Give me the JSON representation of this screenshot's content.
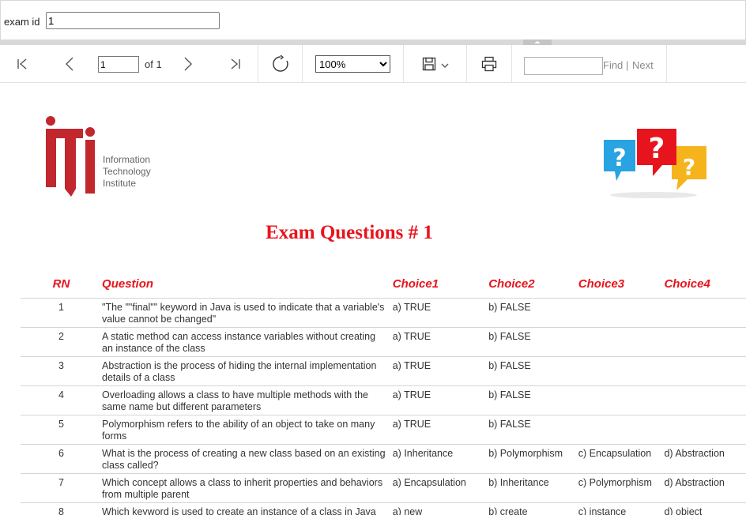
{
  "parameters": {
    "exam_id_label": "exam id",
    "exam_id_value": "1"
  },
  "toolbar": {
    "current_page": "1",
    "page_total_text": "of 1",
    "zoom_options": [
      "100%"
    ],
    "zoom_selected": "100%",
    "find_placeholder": "",
    "find_label": "Find",
    "separator": "|",
    "next_label": "Next",
    "icons": [
      "first-page-icon",
      "previous-page-icon",
      "next-page-icon",
      "last-page-icon",
      "refresh-icon",
      "save-icon",
      "chevron-down-icon",
      "print-icon"
    ]
  },
  "report": {
    "logo": {
      "line1": "Information",
      "line2": "Technology",
      "line3": "Institute",
      "colors": {
        "red": "#c1272d",
        "gray": "#666666"
      }
    },
    "title": "Exam Questions # 1",
    "title_color": "#e8141d",
    "columns": [
      "RN",
      "Question",
      "Choice1",
      "Choice2",
      "Choice3",
      "Choice4"
    ],
    "rows": [
      {
        "rn": "1",
        "question": "\"The \"\"final\"\" keyword in Java is used to indicate that a variable's value cannot be changed\"",
        "c1": "a) TRUE",
        "c2": "b) FALSE",
        "c3": "",
        "c4": ""
      },
      {
        "rn": "2",
        "question": "A static method can access instance variables without creating an instance of the class",
        "c1": "a) TRUE",
        "c2": "b) FALSE",
        "c3": "",
        "c4": ""
      },
      {
        "rn": "3",
        "question": "Abstraction is the process of hiding the internal implementation details of a class",
        "c1": "a) TRUE",
        "c2": "b) FALSE",
        "c3": "",
        "c4": ""
      },
      {
        "rn": "4",
        "question": "Overloading allows a class to have multiple methods with the same name but different parameters",
        "c1": "a) TRUE",
        "c2": "b) FALSE",
        "c3": "",
        "c4": ""
      },
      {
        "rn": "5",
        "question": "Polymorphism refers to the ability of an object to take on many forms",
        "c1": "a) TRUE",
        "c2": "b) FALSE",
        "c3": "",
        "c4": ""
      },
      {
        "rn": "6",
        "question": "What is the process of creating a new class based on an existing class called?",
        "c1": "a) Inheritance",
        "c2": "b) Polymorphism",
        "c3": "c) Encapsulation",
        "c4": "d) Abstraction"
      },
      {
        "rn": "7",
        "question": "Which concept allows a class to inherit properties and behaviors from multiple parent",
        "c1": "a) Encapsulation",
        "c2": "b) Inheritance",
        "c3": "c) Polymorphism",
        "c4": "d) Abstraction"
      },
      {
        "rn": "8",
        "question": "Which keyword is used to create an instance of a class in Java",
        "c1": "a) new",
        "c2": "b) create",
        "c3": "c) instance",
        "c4": "d) object"
      }
    ]
  }
}
